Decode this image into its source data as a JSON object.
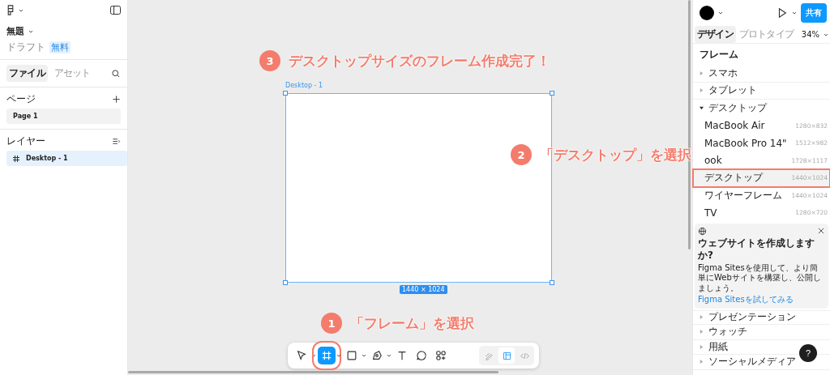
{
  "file_menu": {
    "title": "無題",
    "location": "ドラフト",
    "plan": "無料"
  },
  "left_tabs": [
    {
      "label": "ファイル",
      "selected": true
    },
    {
      "label": "アセット",
      "selected": false
    }
  ],
  "pages": {
    "heading": "ページ",
    "items": [
      {
        "label": "Page 1",
        "selected": true
      }
    ]
  },
  "layers": {
    "heading": "レイヤー",
    "items": [
      {
        "label": "Desktop - 1",
        "selected": true
      }
    ]
  },
  "canvas": {
    "frame": {
      "label": "Desktop - 1",
      "size": "1440 × 1024"
    }
  },
  "toolbar": {
    "tools": [
      {
        "kind": "move",
        "selected": false,
        "dropdown": true
      },
      {
        "kind": "frame",
        "selected": true,
        "dropdown": true
      },
      {
        "kind": "shape",
        "selected": false,
        "dropdown": true
      },
      {
        "kind": "pen",
        "selected": false,
        "dropdown": true
      },
      {
        "kind": "text",
        "selected": false,
        "dropdown": false
      },
      {
        "kind": "comment",
        "selected": false,
        "dropdown": false
      },
      {
        "kind": "actions",
        "selected": false,
        "dropdown": false
      }
    ],
    "modes": [
      {
        "kind": "draw",
        "selected": false
      },
      {
        "kind": "design",
        "selected": true
      },
      {
        "kind": "dev",
        "selected": false
      }
    ]
  },
  "header": {
    "share": "共有",
    "zoom": "34%"
  },
  "right_tabs": [
    {
      "label": "デザイン",
      "selected": true
    },
    {
      "label": "プロトタイプ",
      "selected": false
    }
  ],
  "frame_panel": {
    "heading": "フレーム",
    "groups": [
      {
        "label": "スマホ",
        "expanded": false
      },
      {
        "label": "タブレット",
        "expanded": false
      },
      {
        "label": "デスクトップ",
        "expanded": true,
        "items": [
          {
            "name": "MacBook Air",
            "size": "1280×832",
            "selected": false
          },
          {
            "name": "MacBook Pro 14\"",
            "size": "1512×982",
            "selected": false
          },
          {
            "name": "ook",
            "size": "1728×1117",
            "selected": false
          },
          {
            "name": "デスクトップ",
            "size": "1440×1024",
            "selected": true
          },
          {
            "name": "ワイヤーフレーム",
            "size": "1440×1024",
            "selected": false
          },
          {
            "name": "TV",
            "size": "1280×720",
            "selected": false
          }
        ]
      }
    ],
    "promo": {
      "title": "ウェブサイトを作成しますか?",
      "body": "Figma Sitesを使用して、より簡単にWebサイトを構築し、公開しましょう。",
      "link": "Figma Sitesを試してみる"
    },
    "more_groups": [
      {
        "label": "プレゼンテーション",
        "expanded": false
      },
      {
        "label": "ウォッチ",
        "expanded": false
      },
      {
        "label": "用紙",
        "expanded": false
      },
      {
        "label": "ソーシャルメディア",
        "expanded": false
      }
    ]
  },
  "help": "?",
  "annotations": [
    {
      "number": "3",
      "text": "デスクトップサイズのフレーム作成完了！"
    },
    {
      "number": "2",
      "text": "「デスクトップ」を選択"
    },
    {
      "number": "1",
      "text": "「フレーム」を選択"
    }
  ]
}
